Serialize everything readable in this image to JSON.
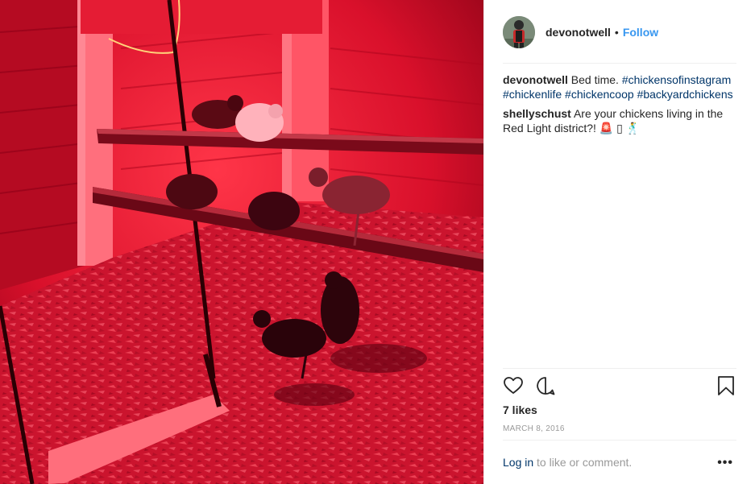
{
  "post": {
    "author": "devonotwell",
    "separator": "•",
    "follow_label": "Follow",
    "comments": [
      {
        "user": "devonotwell",
        "text": "Bed time.",
        "hashtags": [
          "#chickensofinstagram",
          "#chickenlife",
          "#chickencoop",
          "#backyardchickens"
        ]
      },
      {
        "user": "shellyschust",
        "text": "Are your chickens living in the Red Light district?! 🚨 ▯ 🕺"
      }
    ],
    "likes": "7 likes",
    "date": "MARCH 8, 2016",
    "login_link": "Log in",
    "login_text": " to like or comment.",
    "more_label": "•••"
  },
  "icons": {
    "like": "heart-icon",
    "comment": "comment-bubble-icon",
    "save": "bookmark-icon",
    "more": "more-options-icon"
  },
  "colors": {
    "follow": "#3897f0",
    "hashtag": "#003569",
    "muted": "#999999",
    "photo_tint": "#d0102a"
  }
}
